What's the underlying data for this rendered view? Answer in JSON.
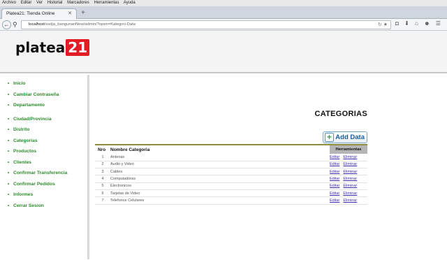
{
  "browser": {
    "menu": [
      "Archivo",
      "Editar",
      "Ver",
      "Historial",
      "Marcadores",
      "Herramientas",
      "Ayuda"
    ],
    "tab_title": "Platea21: Tienda Online",
    "url_host": "localhost",
    "url_path": "/ssdja_bangunanNew/admin/?open=Kategori-Data"
  },
  "site": {
    "logo_text": "platea",
    "logo_number": "21"
  },
  "sidebar": {
    "items": [
      {
        "label": "Inicio"
      },
      {
        "label": "Cambiar Contraseña"
      },
      {
        "label": "Departamento"
      },
      {
        "label": "Ciudad/Provincia"
      },
      {
        "label": "Distrito"
      },
      {
        "label": "Categorias"
      },
      {
        "label": "Productos"
      },
      {
        "label": "Clientes"
      },
      {
        "label": "Confirmar Transferencia"
      },
      {
        "label": "Confirmar Pedidos"
      },
      {
        "label": "Informes"
      },
      {
        "label": "Cerrar Sesion"
      }
    ]
  },
  "main": {
    "title": "CATEGORIAS",
    "add_label": "Add Data",
    "columns": {
      "nro": "Nro",
      "name": "Nombre Categoria",
      "tools": "Herramientas"
    },
    "edit_label": "Editar",
    "delete_label": "Eliminar",
    "rows": [
      {
        "n": "1",
        "name": "Antenas"
      },
      {
        "n": "2",
        "name": "Audio y Video"
      },
      {
        "n": "3",
        "name": "Cables"
      },
      {
        "n": "4",
        "name": "Computadoras"
      },
      {
        "n": "5",
        "name": "Electronicos"
      },
      {
        "n": "6",
        "name": "Tarjetas de Video"
      },
      {
        "n": "7",
        "name": "Telefonos Celulares"
      }
    ]
  }
}
